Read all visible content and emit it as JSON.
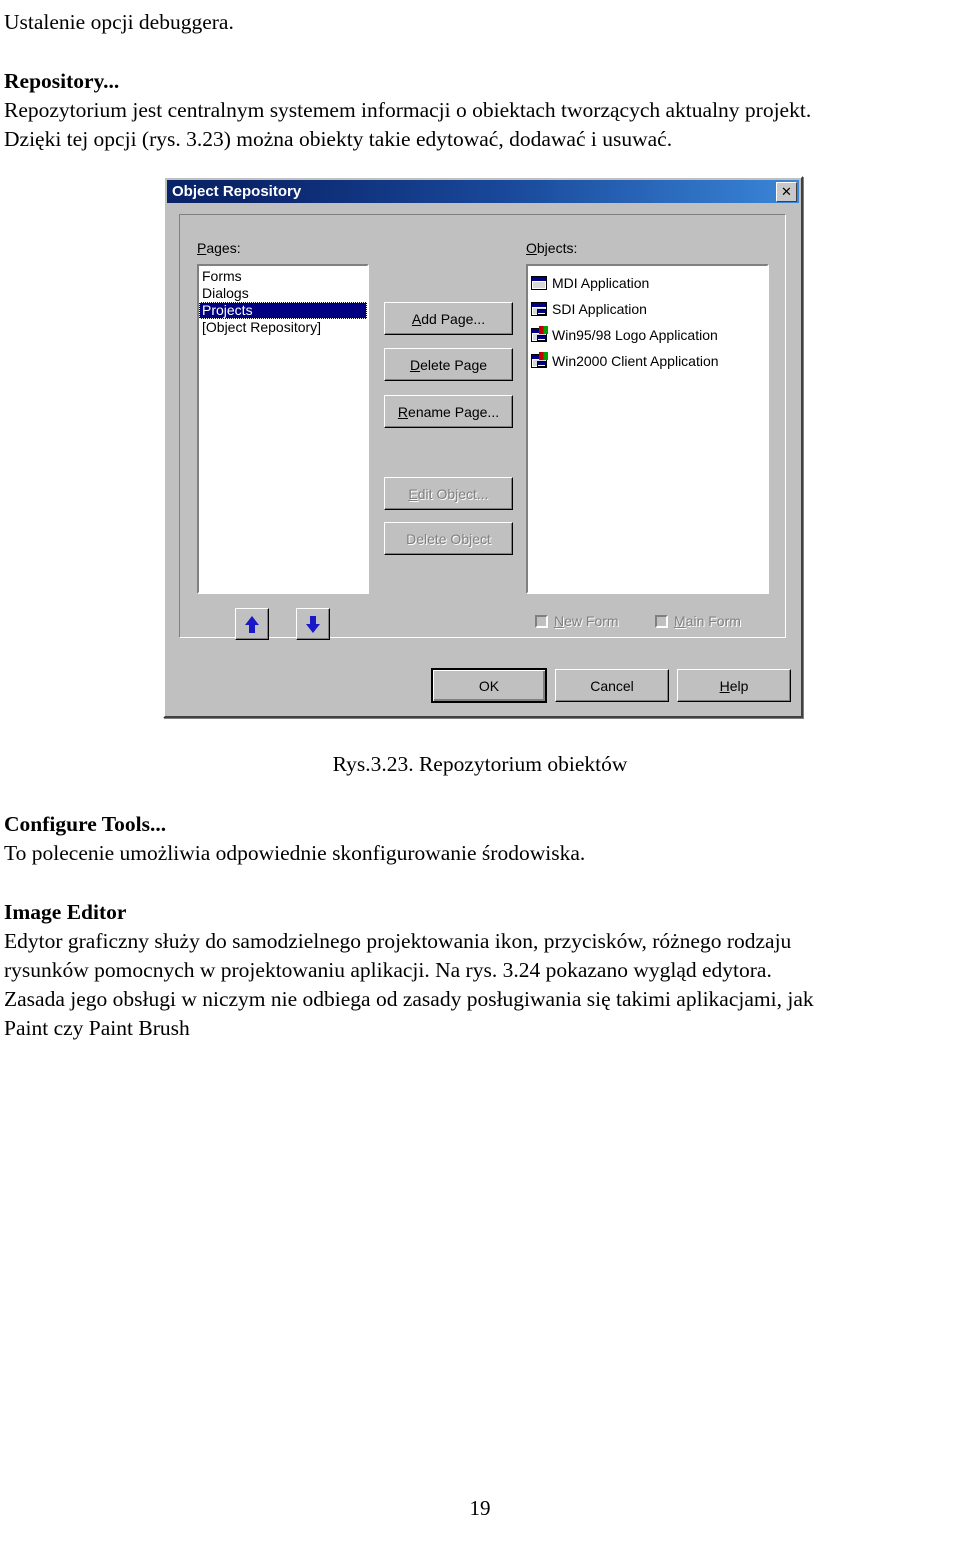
{
  "document": {
    "intro_line": "Ustalenie opcji debuggera.",
    "section_repository": {
      "heading": "Repository...",
      "paragraph_line1": "Repozytorium jest centralnym systemem informacji o obiektach tworzących aktualny projekt.",
      "paragraph_line2": "Dzięki tej opcji (rys. 3.23) można obiekty takie edytować, dodawać i usuwać."
    },
    "figure_caption": "Rys.3.23. Repozytorium obiektów",
    "section_configure_tools": {
      "heading": "Configure Tools...",
      "paragraph": "To polecenie umożliwia odpowiednie skonfigurowanie środowiska."
    },
    "section_image_editor": {
      "heading": "Image Editor",
      "paragraph_line1": "Edytor graficzny służy  do samodzielnego projektowania ikon, przycisków, różnego rodzaju",
      "paragraph_line2": "rysunków pomocnych w projektowaniu aplikacji. Na rys. 3.24  pokazano wygląd edytora.",
      "paragraph_line3": "Zasada jego obsługi w niczym nie odbiega od zasady posługiwania się takimi aplikacjami, jak",
      "paragraph_line4": "Paint czy Paint Brush"
    },
    "page_number": "19"
  },
  "dialog": {
    "title": "Object Repository",
    "close_glyph": "✕",
    "colors": {
      "titlebar_start": "#0a246a",
      "titlebar_end": "#3a86d8",
      "face": "#c0c0c0",
      "selection": "#000080",
      "arrow_blue": "#1818c8",
      "disabled_text": "#808080"
    },
    "pages_label": "Pages:",
    "pages_label_accel": "P",
    "pages_label_rest": "ages:",
    "pages_items": [
      {
        "label": "Forms",
        "selected": false
      },
      {
        "label": "Dialogs",
        "selected": false
      },
      {
        "label": "Projects",
        "selected": true
      },
      {
        "label": "[Object Repository]",
        "selected": false
      }
    ],
    "objects_label_accel": "O",
    "objects_label_rest": "bjects:",
    "objects_items": [
      {
        "label": "MDI Application",
        "icon": "mdi-window-icon"
      },
      {
        "label": "SDI Application",
        "icon": "sdi-window-icon"
      },
      {
        "label": "Win95/98 Logo Application",
        "icon": "win9x-logo-window-icon"
      },
      {
        "label": "Win2000 Client Application",
        "icon": "win2000-window-icon"
      }
    ],
    "buttons": {
      "add_page": {
        "accel": "A",
        "rest": "dd Page...",
        "enabled": true
      },
      "delete_page": {
        "accel": "D",
        "rest": "elete Page",
        "enabled": true
      },
      "rename_page": {
        "accel": "R",
        "rest": "ename Page...",
        "enabled": true
      },
      "edit_object": {
        "accel": "E",
        "rest": "dit Object...",
        "enabled": false
      },
      "delete_object": {
        "accel": "",
        "rest": "Delete Object",
        "enabled": false
      }
    },
    "move_up_title": "Move Up",
    "move_down_title": "Move Down",
    "checkboxes": [
      {
        "accel": "N",
        "rest": "ew Form",
        "checked": false,
        "enabled": false
      },
      {
        "accel": "M",
        "rest": "ain Form",
        "checked": false,
        "enabled": false
      }
    ],
    "footer_buttons": {
      "ok": {
        "label": "OK",
        "default": true
      },
      "cancel": {
        "label": "Cancel",
        "default": false
      },
      "help_accel": "H",
      "help_rest": "elp"
    }
  }
}
